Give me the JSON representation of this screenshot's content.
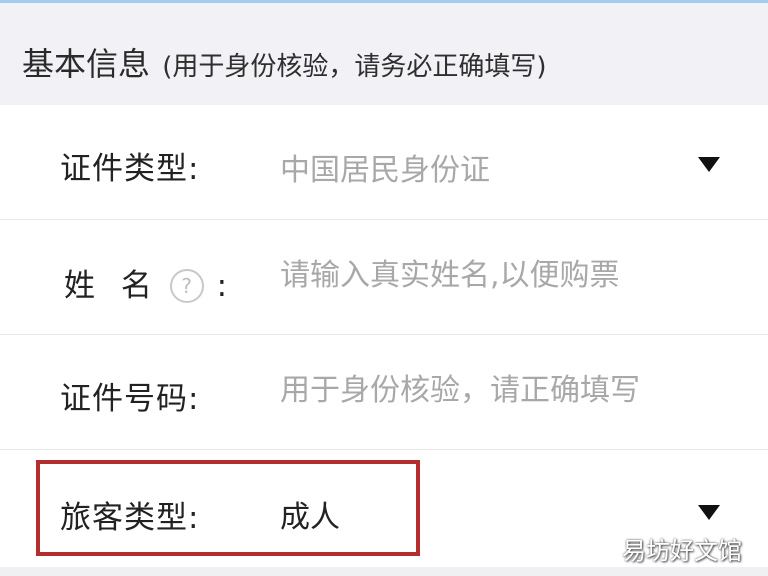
{
  "section": {
    "title": "基本信息",
    "hint": "(用于身份核验，请务必正确填写)"
  },
  "form": {
    "id_type": {
      "label": "证件类型:",
      "value": "中国居民身份证",
      "icon": "dropdown-caret-icon"
    },
    "name": {
      "label_part1": "姓",
      "label_part2": "名",
      "help_icon_glyph": "?",
      "colon": ":",
      "placeholder": "请输入真实姓名,以便购票"
    },
    "id_number": {
      "label": "证件号码:",
      "placeholder": "用于身份核验，请正确填写"
    },
    "passenger_type": {
      "label": "旅客类型:",
      "value": "成人",
      "icon": "dropdown-caret-icon"
    }
  },
  "watermark": "易坊好文馆",
  "colors": {
    "highlight": "#b42e2e",
    "placeholder": "#a8a8a8",
    "text": "#222222"
  }
}
